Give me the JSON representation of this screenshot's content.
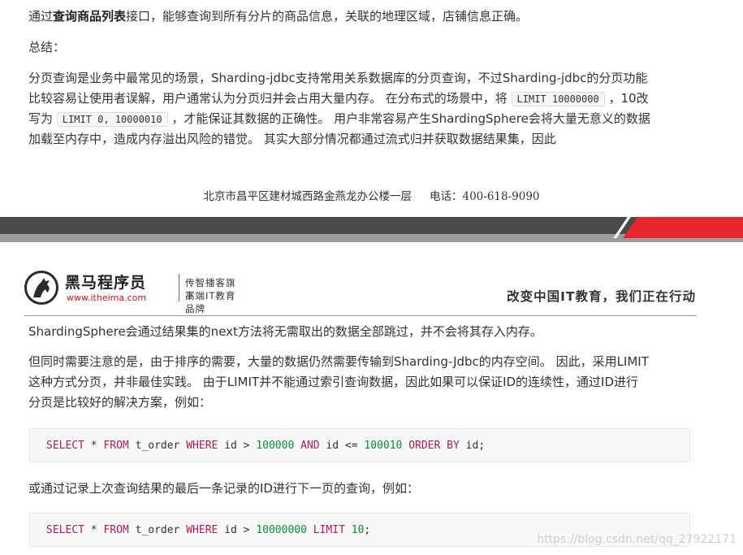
{
  "top": {
    "p1": {
      "pre": "通过",
      "bold": "查询商品列表",
      "post": "接口，能够查询到所有分片的商品信息，关联的地理区域，店铺信息正确。"
    },
    "summary_label": "总结：",
    "p2": {
      "l1": "分页查询是业务中最常见的场景，Sharding-jdbc支持常用关系数据库的分页查询，不过Sharding-jdbc的分页功能",
      "l2_pre": "比较容易让使用者误解，用户通常认为分页归并会占用大量内存。 在分布式的场景中，将 ",
      "l2_code": "LIMIT 10000000",
      "l2_post": " ，10改",
      "l3_pre": "写为 ",
      "l3_code": "LIMIT 0, 10000010",
      "l3_post": " ，才能保证其数据的正确性。 用户非常容易产生ShardingSphere会将大量无意义的数据",
      "l4": "加载至内存中，造成内存溢出风险的错觉。 其实大部分情况都通过流式归并获取数据结果集，因此"
    },
    "footer": {
      "address": "北京市昌平区建材城西路金燕龙办公楼一层",
      "phone": "电话：400-618-9090"
    }
  },
  "header": {
    "brand_name": "黑马程序员",
    "brand_url": "www.itheima.com",
    "tagline1": "传智播客旗下",
    "tagline2": "高端IT教育品牌",
    "slogan": "改变中国IT教育，我们正在行动"
  },
  "bottom": {
    "p3": "ShardingSphere会通过结果集的next方法将无需取出的数据全部跳过，并不会将其存入内存。",
    "p4": {
      "l1": "但同时需要注意的是，由于排序的需要，大量的数据仍然需要传输到Sharding-Jdbc的内存空间。 因此，采用LIMIT",
      "l2": "这种方式分页，并非最佳实践。 由于LIMIT并不能通过索引查询数据，因此如果可以保证ID的连续性，通过ID进行",
      "l3": "分页是比较好的解决方案，例如："
    },
    "code1": {
      "t1": "SELECT",
      "t2": " * ",
      "t3": "FROM",
      "t4": " t_order ",
      "t5": "WHERE",
      "t6": " id > ",
      "t7": "100000",
      "t8": " ",
      "t9": "AND",
      "t10": " id <= ",
      "t11": "100010",
      "t12": " ",
      "t13": "ORDER BY",
      "t14": " id;"
    },
    "p5": "或通过记录上次查询结果的最后一条记录的ID进行下一页的查询，例如：",
    "code2": {
      "t1": "SELECT",
      "t2": " * ",
      "t3": "FROM",
      "t4": " t_order ",
      "t5": "WHERE",
      "t6": " id > ",
      "t7": "10000000",
      "t8": " ",
      "t9": "LIMIT",
      "t10": " ",
      "t11": "10",
      "t12": ";"
    },
    "watermark": "https://blog.csdn.net/qq_27922171"
  },
  "colors": {
    "accent_red": "#e8252a",
    "band_dark": "#4a4a4a",
    "keyword": "#a71d5d",
    "number": "#0b8a3f"
  }
}
